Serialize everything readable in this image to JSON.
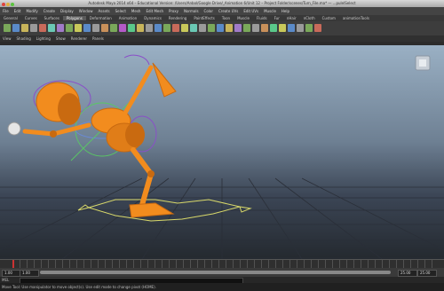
{
  "titlebar": {
    "title": "Autodesk Maya 2014 x64 – Educational Version: /Users/Anbol/Google Drive/_Animation 6/Unit 12 – Project Folder/scenes/Turn_File.ma*  —  ...pulelSelect"
  },
  "menubar": {
    "items": [
      "File",
      "Edit",
      "Modify",
      "Create",
      "Display",
      "Window",
      "Assets",
      "Select",
      "Mesh",
      "Edit Mesh",
      "Proxy",
      "Normals",
      "Color",
      "Create UVs",
      "Edit UVs",
      "Muscle",
      "Help"
    ]
  },
  "shelf": {
    "tabs": [
      "General",
      "Curves",
      "Surfaces",
      "Polygons",
      "Deformation",
      "Animation",
      "Dynamics",
      "Rendering",
      "PaintEffects",
      "Toon",
      "Muscle",
      "Fluids",
      "Fur",
      "nHair",
      "nCloth",
      "Custom",
      "animationTools"
    ],
    "active_tab": "Polygons"
  },
  "panel_menu": {
    "items": [
      "View",
      "Shading",
      "Lighting",
      "Show",
      "Renderer",
      "Panels"
    ]
  },
  "range": {
    "start": "1.00",
    "current": "1.00",
    "end": "25.00",
    "end2": "25.00"
  },
  "cmdline": {
    "label": "MEL"
  },
  "helpline": {
    "text": "Move Tool: Use manipulator to move object(s). Use edit mode to change pivot (HOME)."
  },
  "colors": {
    "rig": "#f28c1e",
    "rig_dark": "#c96a10",
    "nurbs_yellow": "#d9d96a",
    "nurbs_purple": "#8a4fc8",
    "grid": "#2a2f38"
  }
}
